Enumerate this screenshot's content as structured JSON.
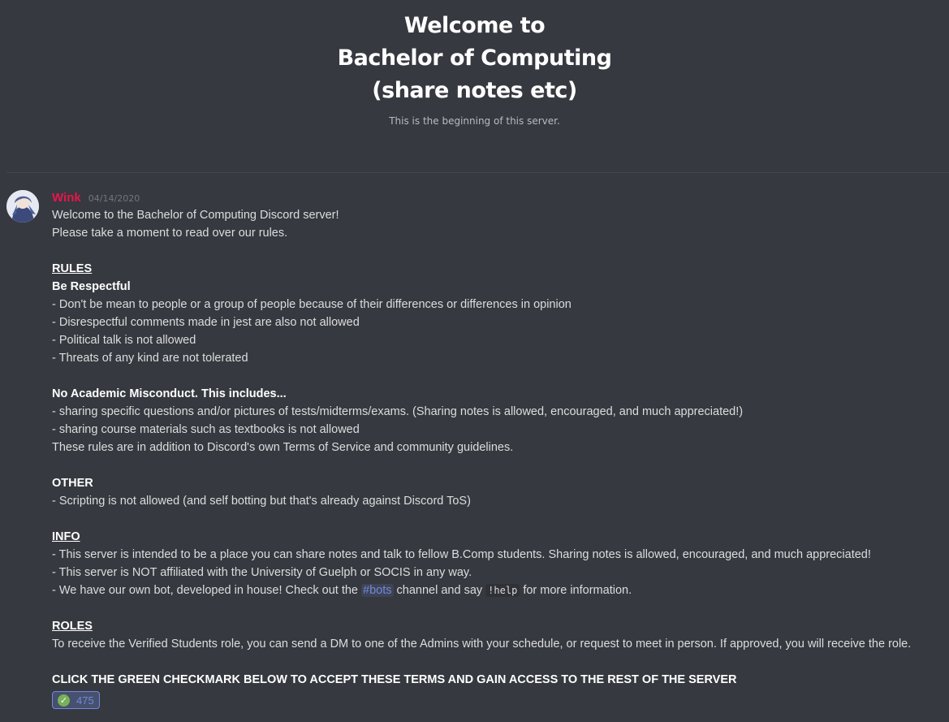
{
  "welcome": {
    "title_line1": "Welcome to",
    "title_line2": "Bachelor of Computing",
    "title_line3": "(share notes etc)",
    "subtitle": "This is the beginning of this server."
  },
  "message": {
    "author": "Wink",
    "author_color": "#e9144c",
    "timestamp": "04/14/2020",
    "lines": {
      "l1": "Welcome to the Bachelor of Computing Discord server!",
      "l2": "Please take a moment to read over our rules.",
      "rules_heading": "RULES",
      "be_respectful": "Be Respectful",
      "r1": "- Don't be mean to people or a group of people because of their differences or differences in opinion",
      "r2": "- Disrespectful comments made in jest are also not allowed",
      "r3": "- Political talk is not allowed",
      "r4": "- Threats of any kind are not tolerated",
      "academic_heading": "No Academic Misconduct. This includes...",
      "a1": "- sharing specific questions and/or pictures of tests/midterms/exams. (Sharing notes is allowed, encouraged, and much appreciated!)",
      "a2": "- sharing course materials such as textbooks is not allowed",
      "a3": "These rules are in addition to Discord's own Terms of Service and community guidelines.",
      "other_heading": "OTHER",
      "o1": "- Scripting is not allowed (and self botting but that's already against Discord ToS)",
      "info_heading": "INFO",
      "i1": "- This server is intended to be a place you can share notes and talk to fellow B.Comp students. Sharing notes is allowed, encouraged, and much appreciated!",
      "i2": "- This server is NOT affiliated with the University of Guelph or SOCIS in any way.",
      "i3_pre": "- We have our own bot, developed in house! Check out the ",
      "i3_channel": "#bots",
      "i3_mid": " channel and say ",
      "i3_code": "!help",
      "i3_post": " for more information.",
      "roles_heading": "ROLES",
      "ro1": "To receive the Verified Students role, you can send a DM to one of the Admins with your schedule, or request to meet in person. If approved, you will receive the role.",
      "cta": "CLICK THE GREEN CHECKMARK BELOW TO ACCEPT THESE TERMS AND GAIN ACCESS TO THE REST OF THE SERVER"
    },
    "reaction": {
      "emoji_icon": "white-check-mark-icon",
      "emoji_glyph": "✓",
      "count": "475"
    }
  },
  "colors": {
    "background": "#36393f",
    "mention": "#7289da",
    "check_green": "#78b159"
  }
}
